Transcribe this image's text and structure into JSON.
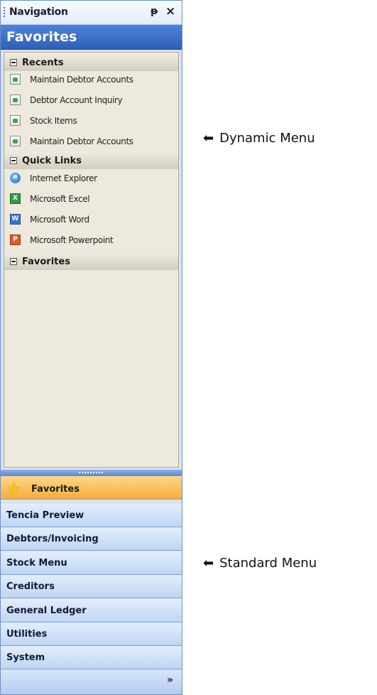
{
  "panel": {
    "title": "Navigation",
    "pin_glyph": "ᵽ",
    "close_glyph": "×",
    "header": "Favorites"
  },
  "groups": [
    {
      "label": "Recents",
      "items": [
        {
          "label": "Maintain Debtor Accounts",
          "icon": "form-icon"
        },
        {
          "label": "Debtor Account Inquiry",
          "icon": "form-icon"
        },
        {
          "label": "Stock Items",
          "icon": "form-icon"
        },
        {
          "label": "Maintain Debtor Accounts",
          "icon": "form-icon"
        }
      ]
    },
    {
      "label": "Quick Links",
      "items": [
        {
          "label": "Internet Explorer",
          "icon": "internet-explorer-icon"
        },
        {
          "label": "Microsoft Excel",
          "icon": "excel-icon"
        },
        {
          "label": "Microsoft Word",
          "icon": "word-icon"
        },
        {
          "label": "Microsoft Powerpoint",
          "icon": "powerpoint-icon"
        }
      ]
    },
    {
      "label": "Favorites",
      "items": []
    }
  ],
  "nav_buttons": [
    {
      "label": "Favorites",
      "active": true
    },
    {
      "label": "Tencia Preview"
    },
    {
      "label": "Debtors/Invoicing"
    },
    {
      "label": "Stock Menu"
    },
    {
      "label": "Creditors"
    },
    {
      "label": "General Ledger"
    },
    {
      "label": "Utilities"
    },
    {
      "label": "System"
    }
  ],
  "more_glyph": "»",
  "annotations": {
    "dynamic": "Dynamic Menu",
    "standard": "Standard Menu"
  },
  "colors": {
    "header_blue": "#2f5fb8",
    "active_orange": "#f6ad3b",
    "content_bg": "#ede9dd"
  }
}
